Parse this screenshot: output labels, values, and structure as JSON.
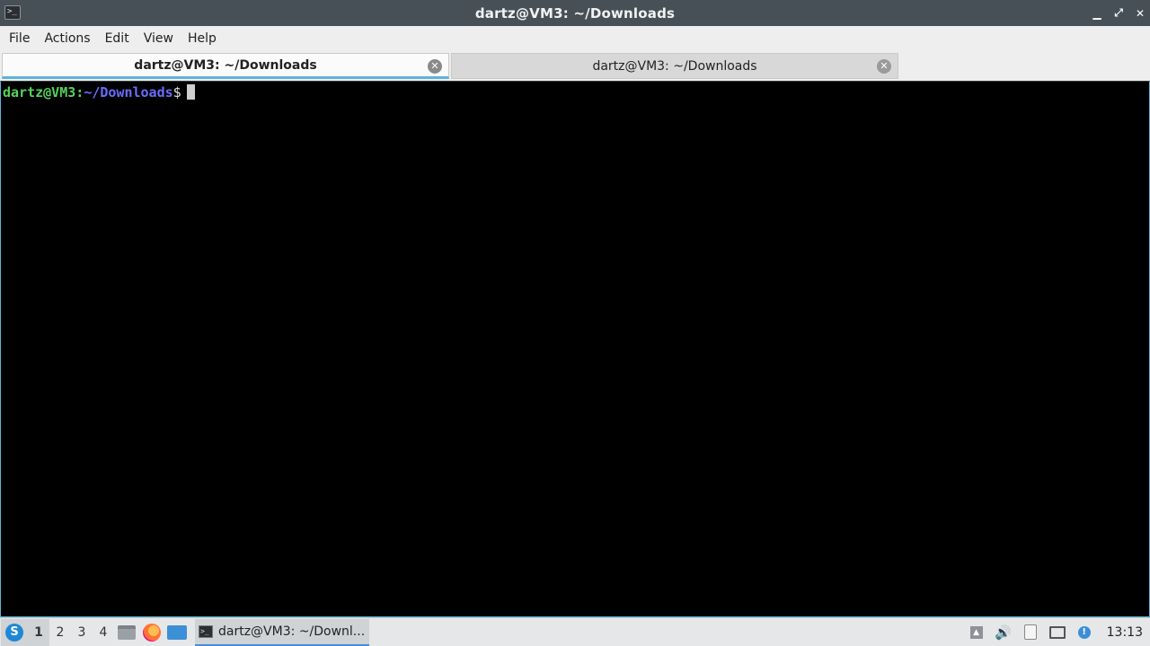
{
  "window": {
    "title": "dartz@VM3: ~/Downloads",
    "app_icon": ">_",
    "minimize_glyph": "▁",
    "maximize_glyph": "⤢",
    "close_glyph": "✕"
  },
  "menubar": {
    "items": [
      "File",
      "Actions",
      "Edit",
      "View",
      "Help"
    ]
  },
  "tabs": [
    {
      "label": "dartz@VM3: ~/Downloads",
      "active": true,
      "close_glyph": "✕"
    },
    {
      "label": "dartz@VM3: ~/Downloads",
      "active": false,
      "close_glyph": "✕"
    }
  ],
  "terminal": {
    "prompt_user": "dartz@VM3",
    "prompt_sep": ":",
    "prompt_path": "~/Downloads",
    "prompt_sign": "$",
    "colors": {
      "user": "#55d35a",
      "path": "#6a6dfc",
      "background": "#000000"
    }
  },
  "taskbar": {
    "start_icon": "start-menu-icon",
    "desktops": [
      "1",
      "2",
      "3",
      "4"
    ],
    "active_desktop": "1",
    "window_label": "dartz@VM3: ~/Downl...",
    "clock": "13:13",
    "vol_glyph": "🔊",
    "up_glyph": "▲",
    "update_glyph": "!"
  }
}
